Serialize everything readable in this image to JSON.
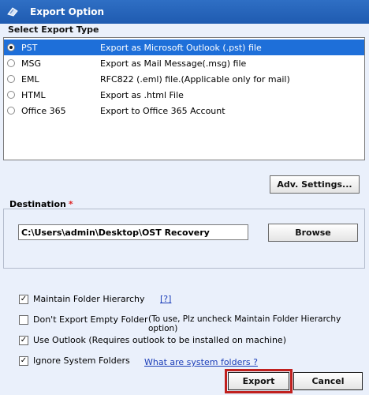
{
  "window": {
    "title": "Export Option",
    "icon": "app-icon"
  },
  "export_type": {
    "heading": "Select Export Type",
    "options": [
      {
        "name": "PST",
        "description": "Export as Microsoft Outlook (.pst) file",
        "selected": true
      },
      {
        "name": "MSG",
        "description": "Export as Mail Message(.msg) file",
        "selected": false
      },
      {
        "name": "EML",
        "description": "RFC822 (.eml) file.(Applicable only for mail)",
        "selected": false
      },
      {
        "name": "HTML",
        "description": "Export as .html File",
        "selected": false
      },
      {
        "name": "Office 365",
        "description": "Export to Office 365 Account",
        "selected": false
      }
    ]
  },
  "adv_settings_label": "Adv. Settings...",
  "destination": {
    "label": "Destination",
    "required_mark": "*",
    "path": "C:\\Users\\admin\\Desktop\\OST Recovery",
    "browse_label": "Browse"
  },
  "options": {
    "maintain_hierarchy": {
      "label": "Maintain Folder Hierarchy",
      "checked": true,
      "help": "[?]"
    },
    "dont_export_empty": {
      "label": "Don't Export Empty Folder",
      "checked": false,
      "note": "(To use, Plz uncheck Maintain Folder Hierarchy option)"
    },
    "use_outlook": {
      "label": "Use Outlook (Requires outlook to be installed on machine)",
      "checked": true
    },
    "ignore_system": {
      "label": "Ignore System Folders",
      "checked": true,
      "help": "What are system folders ?"
    }
  },
  "footer": {
    "export_label": "Export",
    "cancel_label": "Cancel"
  },
  "colors": {
    "titlebar": "#2f6fc4",
    "selection": "#1e6fd9",
    "highlight": "#c0201e",
    "link": "#1a3db8"
  }
}
